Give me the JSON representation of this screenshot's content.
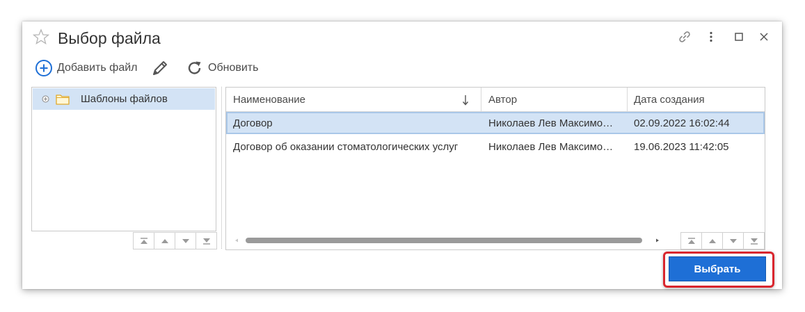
{
  "window": {
    "title": "Выбор файла",
    "icons": [
      "star-icon",
      "link-icon",
      "more-icon",
      "maximize-icon",
      "close-icon"
    ]
  },
  "toolbar": {
    "add_label": "Добавить файл",
    "refresh_label": "Обновить"
  },
  "tree": {
    "items": [
      {
        "label": "Шаблоны файлов",
        "selected": true
      }
    ]
  },
  "grid": {
    "columns": [
      "Наименование",
      "Автор",
      "Дата создания"
    ],
    "sort_column": "Наименование",
    "rows": [
      {
        "name": "Договор",
        "author": "Николаев Лев Максимо…",
        "created": "02.09.2022 16:02:44",
        "selected": true
      },
      {
        "name": "Договор об оказании стоматологических услуг",
        "author": "Николаев Лев Максимо…",
        "created": "19.06.2023 11:42:05",
        "selected": false
      }
    ]
  },
  "footer": {
    "choose_label": "Выбрать"
  },
  "colors": {
    "accent": "#1e6fd6",
    "selection": "#d3e3f5",
    "highlight": "#d9262e"
  }
}
